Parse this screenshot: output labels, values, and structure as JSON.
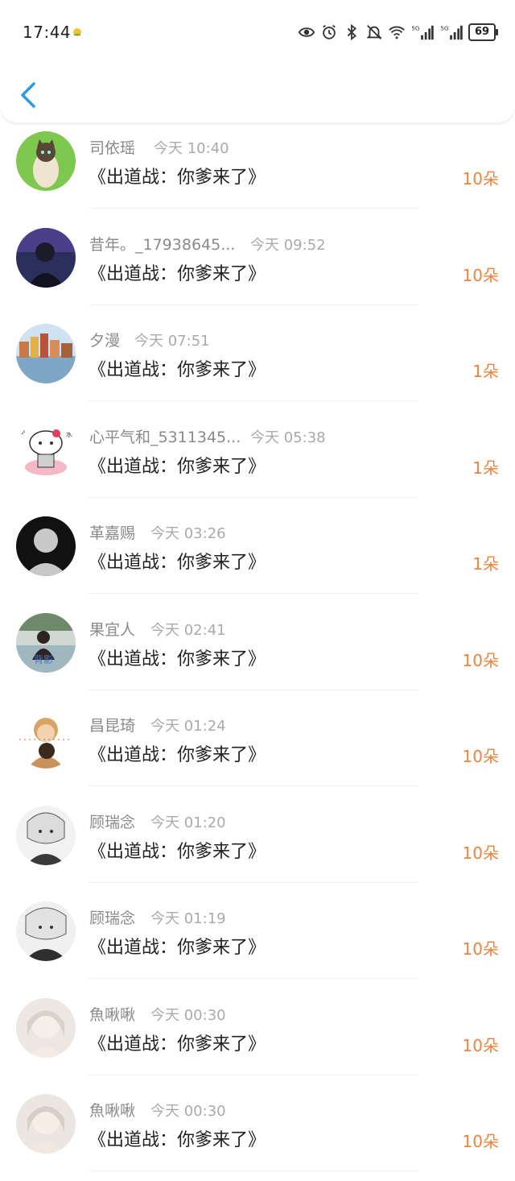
{
  "status": {
    "time": "17:44",
    "battery": "69",
    "icons": [
      "weather-icon",
      "eye-icon",
      "alarm-icon",
      "bluetooth-icon",
      "mute-icon",
      "wifi-icon",
      "signal-5g-icon",
      "signal-5g-icon-2"
    ]
  },
  "colors": {
    "accent": "#2a9be8",
    "count": "#f0823a",
    "name": "#8a8a8a"
  },
  "items": [
    {
      "name": "司依瑶",
      "time": "今天 10:40",
      "title": "《出道战：你爹来了》",
      "count": "10朵",
      "avatar": "cat-avatar"
    },
    {
      "name": "昔年。_17938645...",
      "time": "今天 09:52",
      "title": "《出道战：你爹来了》",
      "count": "10朵",
      "avatar": "person-dark-avatar"
    },
    {
      "name": "夕漫",
      "time": "今天 07:51",
      "title": "《出道战：你爹来了》",
      "count": "1朵",
      "avatar": "city-avatar"
    },
    {
      "name": "心平气和_5311345...",
      "time": "今天 05:38",
      "title": "《出道战：你爹来了》",
      "count": "1朵",
      "avatar": "hello-kitty-avatar"
    },
    {
      "name": "革嘉赐",
      "time": "今天 03:26",
      "title": "《出道战：你爹来了》",
      "count": "1朵",
      "avatar": "default-avatar"
    },
    {
      "name": "果宜人",
      "time": "今天 02:41",
      "title": "《出道战：你爹来了》",
      "count": "10朵",
      "avatar": "girl-field-avatar"
    },
    {
      "name": "昌昆琦",
      "time": "今天 01:24",
      "title": "《出道战：你爹来了》",
      "count": "10朵",
      "avatar": "anime-avatar"
    },
    {
      "name": "顾瑞念",
      "time": "今天 01:20",
      "title": "《出道战：你爹来了》",
      "count": "10朵",
      "avatar": "manga-avatar"
    },
    {
      "name": "顾瑞念",
      "time": "今天 01:19",
      "title": "《出道战：你爹来了》",
      "count": "10朵",
      "avatar": "manga-avatar-2"
    },
    {
      "name": "魚啾啾",
      "time": "今天 00:30",
      "title": "《出道战：你爹来了》",
      "count": "10朵",
      "avatar": "doll-avatar"
    },
    {
      "name": "魚啾啾",
      "time": "今天 00:30",
      "title": "《出道战：你爹来了》",
      "count": "10朵",
      "avatar": "doll-avatar-2"
    }
  ]
}
